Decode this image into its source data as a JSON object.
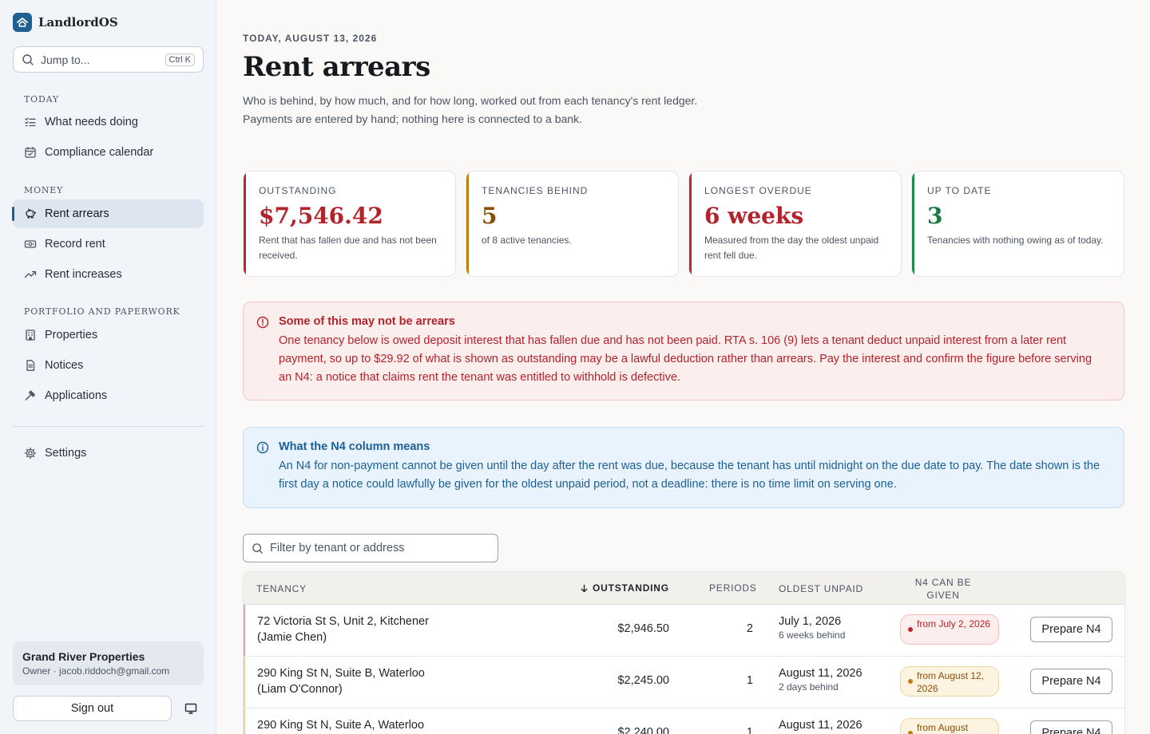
{
  "app": {
    "name": "LandlordOS",
    "jump_placeholder": "Jump to...",
    "jump_shortcut": "Ctrl K"
  },
  "nav": {
    "sections": [
      {
        "title": "TODAY",
        "items": [
          {
            "label": "What needs doing",
            "icon": "checklist-icon"
          },
          {
            "label": "Compliance calendar",
            "icon": "calendar-icon"
          }
        ]
      },
      {
        "title": "MONEY",
        "items": [
          {
            "label": "Rent arrears",
            "icon": "piggy-bank-icon",
            "active": true
          },
          {
            "label": "Record rent",
            "icon": "banknote-icon"
          },
          {
            "label": "Rent increases",
            "icon": "trending-up-icon"
          }
        ]
      },
      {
        "title": "PORTFOLIO AND PAPERWORK",
        "items": [
          {
            "label": "Properties",
            "icon": "building-icon"
          },
          {
            "label": "Notices",
            "icon": "document-icon"
          },
          {
            "label": "Applications",
            "icon": "gavel-icon"
          }
        ]
      }
    ],
    "settings_label": "Settings"
  },
  "account": {
    "name": "Grand River Properties",
    "subtitle": "Owner · jacob.riddoch@gmail.com",
    "sign_out": "Sign out"
  },
  "page": {
    "date": "TODAY, AUGUST 13, 2026",
    "title": "Rent arrears",
    "subtitle_line1": "Who is behind, by how much, and for how long, worked out from each tenancy's rent ledger.",
    "subtitle_line2": "Payments are entered by hand; nothing here is connected to a bank."
  },
  "stats": [
    {
      "label": "OUTSTANDING",
      "value": "$7,546.42",
      "note": "Rent that has fallen due and has not been received.",
      "tone": "red"
    },
    {
      "label": "TENANCIES BEHIND",
      "value": "5",
      "note": "of 8 active tenancies.",
      "tone": "amber"
    },
    {
      "label": "LONGEST OVERDUE",
      "value": "6 weeks",
      "note": "Measured from the day the oldest unpaid rent fell due.",
      "tone": "red"
    },
    {
      "label": "UP TO DATE",
      "value": "3",
      "note": "Tenancies with nothing owing as of today.",
      "tone": "green"
    }
  ],
  "alert": {
    "title": "Some of this may not be arrears",
    "body": "One tenancy below is owed deposit interest that has fallen due and has not been paid. RTA s. 106 (9) lets a tenant deduct unpaid interest from a later rent payment, so up to $29.92 of what is shown as outstanding may be a lawful deduction rather than arrears. Pay the interest and confirm the figure before serving an N4: a notice that claims rent the tenant was entitled to withhold is defective."
  },
  "info": {
    "title": "What the N4 column means",
    "body": "An N4 for non-payment cannot be given until the day after the rent was due, because the tenant has until midnight on the due date to pay. The date shown is the first day a notice could lawfully be given for the oldest unpaid period, not a deadline: there is no time limit on serving one."
  },
  "filter": {
    "placeholder": "Filter by tenant or address"
  },
  "table": {
    "columns": {
      "tenancy": "TENANCY",
      "outstanding": "OUTSTANDING",
      "periods": "PERIODS",
      "oldest": "OLDEST UNPAID",
      "n4": "N4 CAN BE GIVEN"
    },
    "sort_column": "outstanding",
    "sort_direction": "descending",
    "rows": [
      {
        "address": "72 Victoria St S, Unit 2, Kitchener",
        "tenant": "(Jamie Chen)",
        "outstanding": "$2,946.50",
        "periods": "2",
        "oldest_date": "July 1, 2026",
        "oldest_sub": "6 weeks behind",
        "n4": "from July 2, 2026",
        "tone": "red",
        "action": "Prepare N4"
      },
      {
        "address": "290 King St N, Suite B, Waterloo",
        "tenant": "(Liam O'Connor)",
        "outstanding": "$2,245.00",
        "periods": "1",
        "oldest_date": "August 11, 2026",
        "oldest_sub": "2 days behind",
        "n4": "from August 12, 2026",
        "tone": "amber",
        "action": "Prepare N4"
      },
      {
        "address": "290 King St N, Suite A, Waterloo",
        "tenant": "",
        "outstanding": "$2,240.00",
        "periods": "1",
        "oldest_date": "August 11, 2026",
        "oldest_sub": "",
        "n4": "from August",
        "tone": "amber",
        "action": "Prepare N4"
      }
    ]
  },
  "colors": {
    "brand": "#1f5f92",
    "danger": "#b3232a",
    "warning": "#8a4f07",
    "success": "#1a7a43",
    "info": "#1d5f95"
  }
}
